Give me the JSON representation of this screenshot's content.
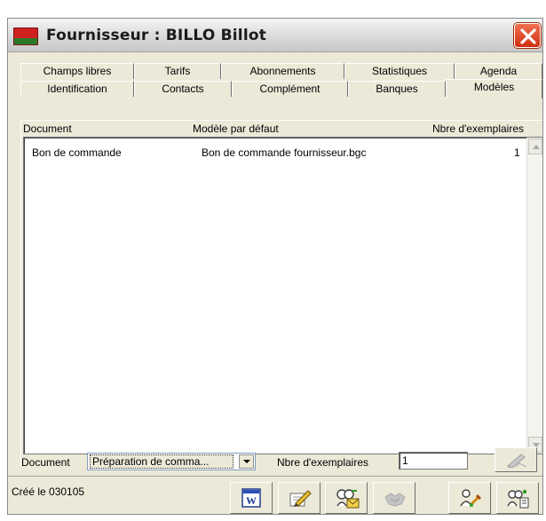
{
  "window": {
    "title": "Fournisseur : BILLO Billot"
  },
  "tabs": {
    "row1": [
      "Champs libres",
      "Tarifs",
      "Abonnements",
      "Statistiques",
      "Agenda"
    ],
    "row2": [
      "Identification",
      "Contacts",
      "Complément",
      "Banques",
      "Modèles"
    ],
    "active": "Modèles"
  },
  "table": {
    "headers": [
      "Document",
      "Modèle par défaut",
      "Nbre d'exemplaires"
    ],
    "rows": [
      [
        "Bon de commande",
        "Bon de commande fournisseur.bgc",
        "1"
      ]
    ]
  },
  "form": {
    "document_label": "Document",
    "document_value": "Préparation de comma...",
    "copies_label": "Nbre d'exemplaires",
    "copies_value": "1"
  },
  "status": {
    "created": "Créé le 030105"
  },
  "toolbar": {
    "icons": [
      "word-icon",
      "edit-pencil-icon",
      "users-mail-icon",
      "handshake-icon",
      "people-tools-icon",
      "people-search-icon"
    ]
  },
  "colors": {
    "window_bg": "#ece9d8",
    "close_red": "#d03010",
    "list_bg": "#ffffff"
  }
}
